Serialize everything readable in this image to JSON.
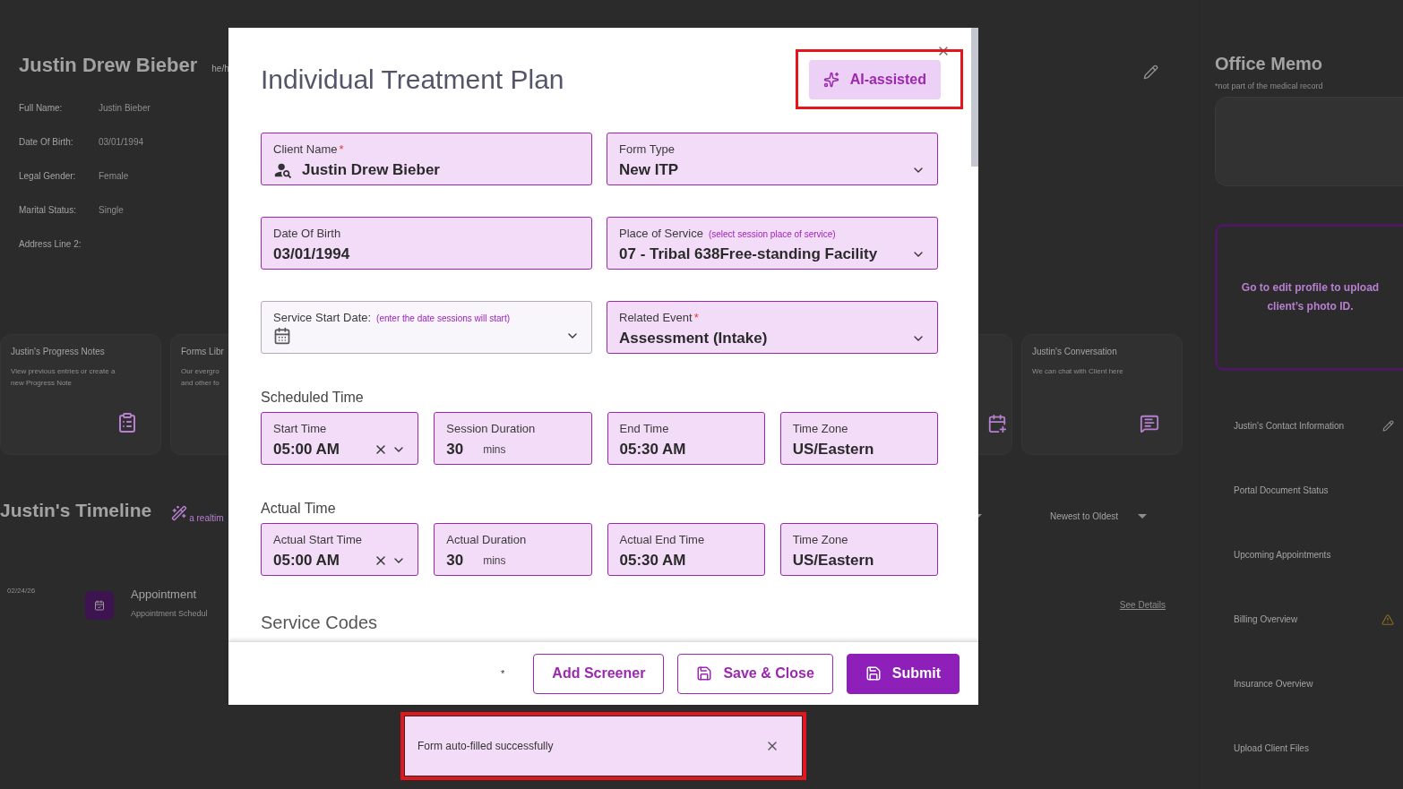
{
  "background": {
    "client_name": "Justin Drew Bieber",
    "pronoun": "he/h",
    "details": [
      {
        "label": "Full Name:",
        "value": "Justin Bieber"
      },
      {
        "label": "Date Of Birth:",
        "value": "03/01/1994"
      },
      {
        "label": "Legal Gender:",
        "value": "Female"
      },
      {
        "label": "Marital Status:",
        "value": "Single"
      },
      {
        "label": "Address Line 2:"
      }
    ],
    "cards": [
      {
        "title": "Justin's Progress Notes",
        "description": [
          "View previous entries or create a",
          "new Progress Note"
        ],
        "kind": "notes"
      },
      {
        "title": "Forms Libr",
        "description": [
          "Our evergro",
          "and other fo"
        ],
        "kind": "plain"
      },
      {
        "kind": "calendar"
      },
      {
        "title": "Justin's Conversation",
        "description": [
          "We can chat with Client here"
        ],
        "kind": "chat"
      }
    ],
    "timeline": {
      "title": "Justin's Timeline",
      "subtitle": "a realtim",
      "sort": "Newest to Oldest",
      "date": "02/24/26",
      "entry_title": "Appointment",
      "entry_subtitle": "Appointment Schedul",
      "link": "See Details"
    },
    "sidebar": {
      "memo_title": "Office Memo",
      "memo_note": "*not part of the medical record",
      "photo_prompt": "Go to edit profile to upload client’s photo ID.",
      "items": [
        {
          "label": "Justin's Contact Information",
          "kind": "edit"
        },
        {
          "label": "Portal Document Status",
          "kind": "plain"
        },
        {
          "label": "Upcoming Appointments",
          "kind": "plain"
        },
        {
          "label": "Billing Overview",
          "kind": "warning"
        },
        {
          "label": "Insurance Overview",
          "kind": "plain"
        },
        {
          "label": "Upload Client Files",
          "kind": "plain"
        }
      ]
    }
  },
  "modal": {
    "title": "Individual Treatment Plan",
    "ai_button": "AI-assisted",
    "rows": [
      {
        "fields": [
          {
            "label": "Client Name",
            "required": true,
            "value": "Justin Drew Bieber",
            "kind": "client",
            "autofilled": true
          },
          {
            "label": "Form Type",
            "required": false,
            "value": "New ITP",
            "kind": "select",
            "autofilled": true
          }
        ]
      },
      {
        "fields": [
          {
            "label": "Date Of Birth",
            "required": false,
            "value": "03/01/1994",
            "kind": "text",
            "autofilled": true
          },
          {
            "label": "Place of Service",
            "required": false,
            "hint": "(select session place of service)",
            "value": "07 - Tribal 638Free-standing Facility",
            "kind": "select",
            "autofilled": true
          }
        ]
      },
      {
        "fields": [
          {
            "label": "Service Start Date:",
            "required": false,
            "hint": "(enter the date sessions will start)",
            "kind": "date",
            "autofilled": false
          },
          {
            "label": "Related Event",
            "required": true,
            "value": "Assessment (Intake)",
            "kind": "select",
            "autofilled": true
          }
        ]
      },
      {
        "section": "Scheduled Time",
        "fields": [
          {
            "label": "Start Time",
            "required": false,
            "value": "05:00 AM",
            "kind": "time",
            "autofilled": true
          },
          {
            "label": "Session Duration",
            "required": false,
            "value": "30",
            "unit": "mins",
            "kind": "duration",
            "autofilled": true
          },
          {
            "label": "End Time",
            "required": false,
            "value": "05:30 AM",
            "kind": "text",
            "autofilled": true
          },
          {
            "label": "Time Zone",
            "required": false,
            "value": "US/Eastern",
            "kind": "text",
            "autofilled": true
          }
        ]
      },
      {
        "section": "Actual Time",
        "fields": [
          {
            "label": "Actual Start Time",
            "required": false,
            "value": "05:00 AM",
            "kind": "time",
            "autofilled": true
          },
          {
            "label": "Actual Duration",
            "required": false,
            "value": "30",
            "unit": "mins",
            "kind": "duration",
            "autofilled": true
          },
          {
            "label": "Actual End Time",
            "required": false,
            "value": "05:30 AM",
            "kind": "text",
            "autofilled": true
          },
          {
            "label": "Time Zone",
            "required": false,
            "value": "US/Eastern",
            "kind": "text",
            "autofilled": true
          }
        ]
      }
    ],
    "next_section": "Service Codes",
    "footer_note": "*",
    "buttons": [
      {
        "label": "Add Screener",
        "kind": "outline",
        "icon": false
      },
      {
        "label": "Save & Close",
        "kind": "outline",
        "icon": true
      },
      {
        "label": "Submit",
        "kind": "primary",
        "icon": true
      }
    ]
  },
  "toast": {
    "message": "Form auto-filled successfully"
  }
}
